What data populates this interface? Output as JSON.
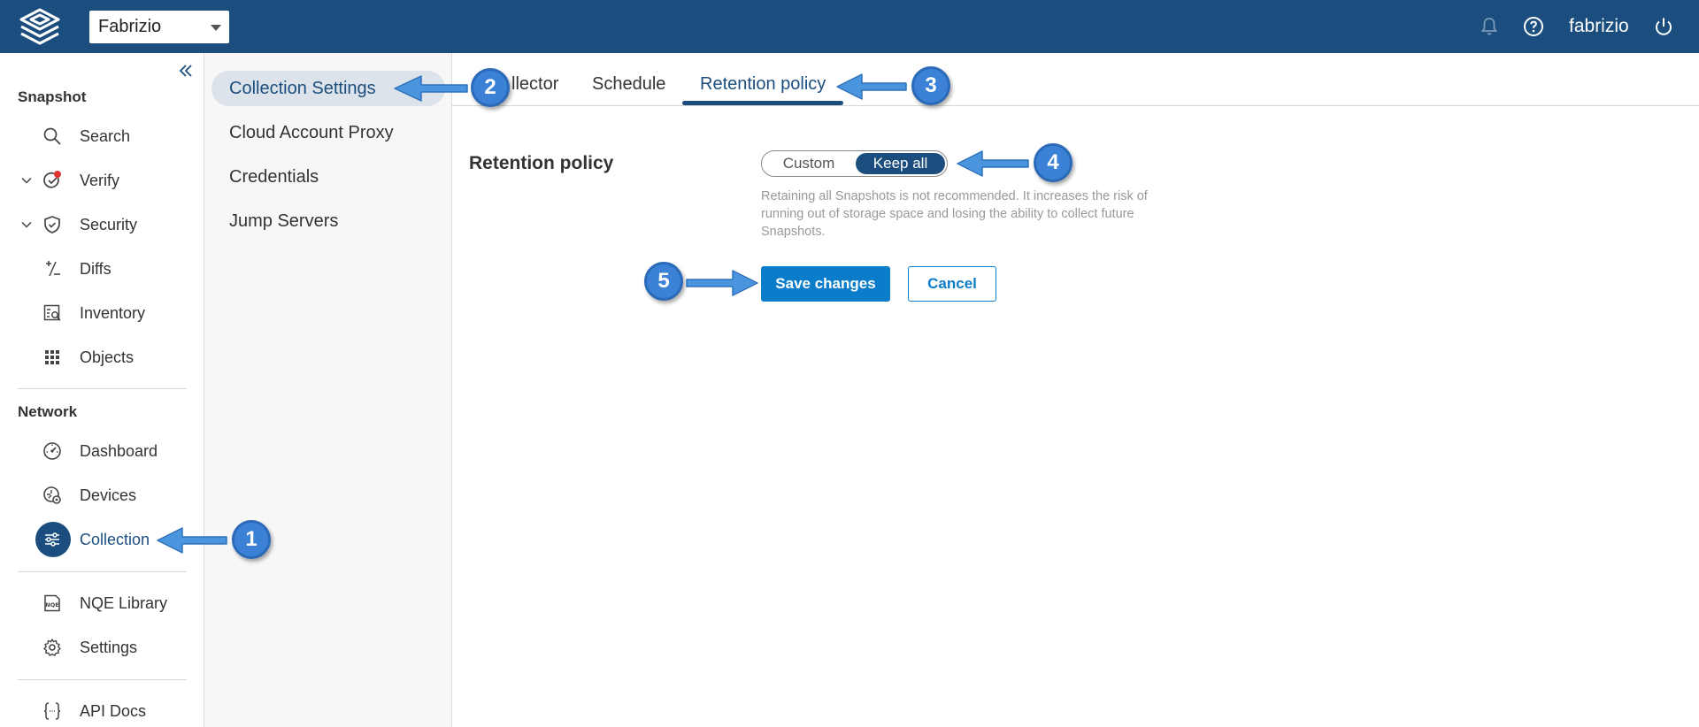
{
  "topbar": {
    "workspace": "Fabrizio",
    "username": "fabrizio"
  },
  "sidebar": {
    "section_snapshot": "Snapshot",
    "section_network": "Network",
    "items": [
      {
        "label": "Search",
        "icon": "search-icon"
      },
      {
        "label": "Verify",
        "icon": "verify-icon"
      },
      {
        "label": "Security",
        "icon": "shield-icon"
      },
      {
        "label": "Diffs",
        "icon": "diffs-icon"
      },
      {
        "label": "Inventory",
        "icon": "inventory-icon"
      },
      {
        "label": "Objects",
        "icon": "grid-icon"
      },
      {
        "label": "Dashboard",
        "icon": "gauge-icon"
      },
      {
        "label": "Devices",
        "icon": "devices-icon"
      },
      {
        "label": "Collection",
        "icon": "sliders-icon"
      },
      {
        "label": "NQE Library",
        "icon": "nqe-icon"
      },
      {
        "label": "Settings",
        "icon": "gear-icon"
      },
      {
        "label": "API Docs",
        "icon": "braces-icon"
      }
    ]
  },
  "subnav": {
    "items": [
      {
        "label": "Collection Settings"
      },
      {
        "label": "Cloud Account Proxy"
      },
      {
        "label": "Credentials"
      },
      {
        "label": "Jump Servers"
      }
    ]
  },
  "tabs": [
    {
      "label": "llector"
    },
    {
      "label": "Schedule"
    },
    {
      "label": "Retention policy"
    }
  ],
  "retention": {
    "label": "Retention policy",
    "options": [
      "Custom",
      "Keep all"
    ],
    "selected": "Keep all",
    "help": "Retaining all Snapshots is not recommended. It increases the risk of running out of storage space and losing the ability to collect future Snapshots.",
    "save_label": "Save changes",
    "cancel_label": "Cancel"
  },
  "callouts": [
    "1",
    "2",
    "3",
    "4",
    "5"
  ],
  "colors": {
    "topbar": "#1b4e7e",
    "accent": "#0a7cc9",
    "callout": "#3b82d6"
  }
}
